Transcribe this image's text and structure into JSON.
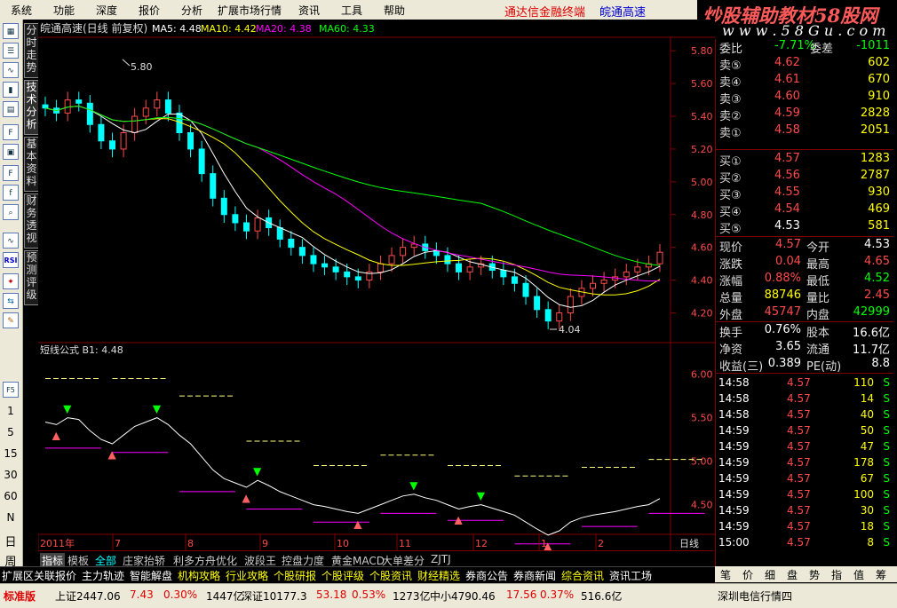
{
  "menu": {
    "items": [
      "系统",
      "功能",
      "深度",
      "报价",
      "分析",
      "扩展市场行情",
      "资讯",
      "工具",
      "帮助"
    ],
    "promo": "通达信金融终端",
    "stock_name": "皖通高速"
  },
  "watermark": {
    "line1": "炒股辅助教材58股网",
    "line2": "w w w . 5 8 G u . c o m"
  },
  "left_toolbar": {
    "icons": [
      "chart-icon",
      "list-icon",
      "trend-icon",
      "bars-icon",
      "grid-icon",
      "f10-icon",
      "calc-icon",
      "f2-icon",
      "f0-icon",
      "search-icon",
      "rsi-icon",
      "RSI",
      "bull-icon",
      "arrows-icon",
      "pen-icon",
      "F5"
    ],
    "periods": [
      "1",
      "5",
      "15",
      "30",
      "60",
      "N",
      "日",
      "周",
      "月"
    ]
  },
  "vertical_tabs": [
    "分时走势",
    "技术分析",
    "基本资料",
    "财务透视",
    "预测评级"
  ],
  "chart": {
    "header": "皖通高速(日线 前复权)",
    "ma": [
      {
        "label": "MA5: 4.48",
        "color": "#ffffff"
      },
      {
        "label": "MA10: 4.42",
        "color": "#ffff00"
      },
      {
        "label": "MA20: 4.38",
        "color": "#ff00ff"
      },
      {
        "label": "MA60: 4.33",
        "color": "#00ff00"
      }
    ],
    "high_label": "5.80",
    "low_label": "4.04",
    "price_axis": [
      "5.80",
      "5.60",
      "5.40",
      "5.20",
      "5.00",
      "4.80",
      "4.60",
      "4.40",
      "4.20"
    ],
    "sub_header": "短线公式  B1: 4.48",
    "sub_axis": [
      "6.00",
      "5.50",
      "5.00",
      "4.50"
    ],
    "months": [
      "2011年",
      "7",
      "8",
      "9",
      "10",
      "11",
      "12",
      "1",
      "2"
    ],
    "period_tag": "日线"
  },
  "chart_data": {
    "type": "candlestick",
    "title": "皖通高速(日线 前复权)",
    "ylim": [
      4.04,
      5.8
    ],
    "x_months": [
      "2011年",
      "7",
      "8",
      "9",
      "10",
      "11",
      "12",
      "1",
      "2"
    ],
    "close_series_approx": [
      5.45,
      5.42,
      5.5,
      5.48,
      5.35,
      5.25,
      5.2,
      5.3,
      5.4,
      5.45,
      5.5,
      5.42,
      5.3,
      5.2,
      5.05,
      4.9,
      4.8,
      4.75,
      4.7,
      4.78,
      4.72,
      4.65,
      4.6,
      4.55,
      4.5,
      4.48,
      4.45,
      4.42,
      4.4,
      4.45,
      4.5,
      4.55,
      4.6,
      4.62,
      4.58,
      4.55,
      4.5,
      4.45,
      4.48,
      4.5,
      4.46,
      4.42,
      4.38,
      4.3,
      4.22,
      4.15,
      4.2,
      4.3,
      4.35,
      4.38,
      4.4,
      4.42,
      4.45,
      4.48,
      4.5,
      4.57
    ],
    "series": [
      {
        "name": "MA5",
        "last": 4.48
      },
      {
        "name": "MA10",
        "last": 4.42
      },
      {
        "name": "MA20",
        "last": 4.38
      },
      {
        "name": "MA60",
        "last": 4.33
      }
    ]
  },
  "quotes": {
    "top_row": {
      "label": "委比",
      "value": "-7.71%",
      "label2": "委差",
      "value2": "-1011"
    },
    "sell": [
      {
        "label": "卖⑤",
        "price": "4.62",
        "vol": "602"
      },
      {
        "label": "卖④",
        "price": "4.61",
        "vol": "670"
      },
      {
        "label": "卖③",
        "price": "4.60",
        "vol": "910"
      },
      {
        "label": "卖②",
        "price": "4.59",
        "vol": "2828"
      },
      {
        "label": "卖①",
        "price": "4.58",
        "vol": "2051"
      }
    ],
    "buy": [
      {
        "label": "买①",
        "price": "4.57",
        "vol": "1283"
      },
      {
        "label": "买②",
        "price": "4.56",
        "vol": "2787"
      },
      {
        "label": "买③",
        "price": "4.55",
        "vol": "930"
      },
      {
        "label": "买④",
        "price": "4.54",
        "vol": "469"
      },
      {
        "label": "买⑤",
        "price": "4.53",
        "vol": "581"
      }
    ],
    "stats": [
      {
        "l1": "现价",
        "v1": "4.57",
        "c1": "#ff4a4a",
        "l2": "今开",
        "v2": "4.53",
        "c2": "#ffffff"
      },
      {
        "l1": "涨跌",
        "v1": "0.04",
        "c1": "#ff4a4a",
        "l2": "最高",
        "v2": "4.65",
        "c2": "#ff4a4a"
      },
      {
        "l1": "涨幅",
        "v1": "0.88%",
        "c1": "#ff4a4a",
        "l2": "最低",
        "v2": "4.52",
        "c2": "#00ff00"
      },
      {
        "l1": "总量",
        "v1": "88746",
        "c1": "#ffff00",
        "l2": "量比",
        "v2": "2.45",
        "c2": "#ff4a4a"
      },
      {
        "l1": "外盘",
        "v1": "45747",
        "c1": "#ff4a4a",
        "l2": "内盘",
        "v2": "42999",
        "c2": "#00ff00"
      }
    ],
    "stats2": [
      {
        "l1": "换手",
        "v1": "0.76%",
        "l2": "股本",
        "v2": "16.6亿"
      },
      {
        "l1": "净资",
        "v1": "3.65",
        "l2": "流通",
        "v2": "11.7亿"
      },
      {
        "l1": "收益(三)",
        "v1": "0.389",
        "l2": "PE(动)",
        "v2": "8.8"
      }
    ],
    "ticks": [
      {
        "time": "14:58",
        "price": "4.57",
        "vol": "110",
        "flag": "S"
      },
      {
        "time": "14:58",
        "price": "4.57",
        "vol": "14",
        "flag": "S"
      },
      {
        "time": "14:58",
        "price": "4.57",
        "vol": "40",
        "flag": "S"
      },
      {
        "time": "14:59",
        "price": "4.57",
        "vol": "50",
        "flag": "S"
      },
      {
        "time": "14:59",
        "price": "4.57",
        "vol": "47",
        "flag": "S"
      },
      {
        "time": "14:59",
        "price": "4.57",
        "vol": "178",
        "flag": "S"
      },
      {
        "time": "14:59",
        "price": "4.57",
        "vol": "67",
        "flag": "S"
      },
      {
        "time": "14:59",
        "price": "4.57",
        "vol": "100",
        "flag": "S"
      },
      {
        "time": "14:59",
        "price": "4.57",
        "vol": "30",
        "flag": "S"
      },
      {
        "time": "14:59",
        "price": "4.57",
        "vol": "18",
        "flag": "S"
      },
      {
        "time": "15:00",
        "price": "4.57",
        "vol": "8",
        "flag": "S"
      }
    ]
  },
  "bottom_tabs": [
    "指标",
    "模板",
    "全部",
    "庄家抬轿",
    "利多方舟优化",
    "波段王",
    "控盘力度",
    "黄金MACD",
    "大单差分",
    "ZJTJ"
  ],
  "sub_tabs": [
    {
      "label": "扩展区",
      "color": "#ffffff"
    },
    {
      "label": "关联报价",
      "color": "#ffffff"
    },
    {
      "label": "主力轨迹",
      "color": "#ffffff"
    },
    {
      "label": "智能解盘",
      "color": "#ffffff"
    },
    {
      "label": "机构攻略",
      "color": "#ffff00"
    },
    {
      "label": "行业攻略",
      "color": "#ffff00"
    },
    {
      "label": "个股研报",
      "color": "#ffff00"
    },
    {
      "label": "个股评级",
      "color": "#ffff00"
    },
    {
      "label": "个股资讯",
      "color": "#ffff00"
    },
    {
      "label": "财经精选",
      "color": "#ffff00"
    },
    {
      "label": "券商公告",
      "color": "#ffffff"
    },
    {
      "label": "券商新闻",
      "color": "#ffffff"
    },
    {
      "label": "综合资讯",
      "color": "#ffff00"
    },
    {
      "label": "资讯工场",
      "color": "#ffffff"
    }
  ],
  "right_tabs": [
    "笔",
    "价",
    "细",
    "盘",
    "势",
    "指",
    "值",
    "筹"
  ],
  "status": {
    "brand": "标准版",
    "sh": "上证2447.06",
    "sh_chg": "7.43",
    "sh_pct": "0.30%",
    "sh_amt": "1447亿",
    "sz": "深证10177.3",
    "sz_chg": "53.18",
    "sz_pct": "0.53%",
    "sz_amt": "1273亿",
    "zx": "中小4790.46",
    "zx_chg": "17.56",
    "zx_pct": "0.37%",
    "zx_amt": "516.6亿",
    "server": "深圳电信行情四"
  }
}
